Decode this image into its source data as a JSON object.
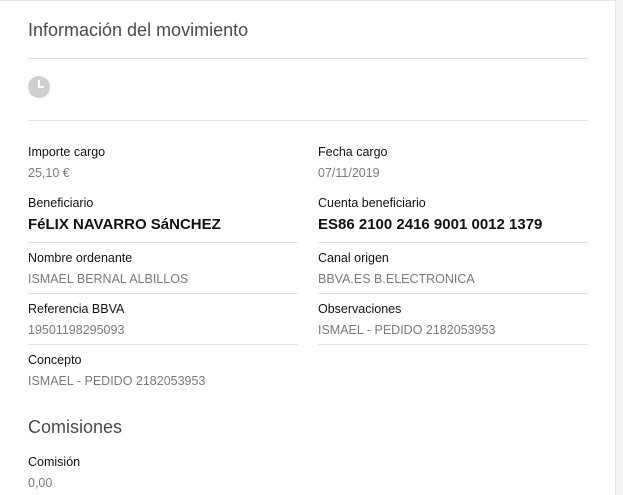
{
  "header": {
    "title": "Información del movimiento"
  },
  "details": {
    "importe_cargo": {
      "label": "Importe cargo",
      "value": "25,10 €"
    },
    "fecha_cargo": {
      "label": "Fecha cargo",
      "value": "07/11/2019"
    },
    "beneficiario": {
      "label": "Beneficiario",
      "value": "FéLIX NAVARRO SáNCHEZ"
    },
    "cuenta_beneficiario": {
      "label": "Cuenta beneficiario",
      "value": "ES86 2100 2416 9001 0012 1379"
    },
    "nombre_ordenante": {
      "label": "Nombre ordenante",
      "value": "ISMAEL BERNAL ALBILLOS"
    },
    "canal_origen": {
      "label": "Canal origen",
      "value": "BBVA.ES B.ELECTRONICA"
    },
    "referencia_bbva": {
      "label": "Referencia BBVA",
      "value": "19501198295093"
    },
    "observaciones": {
      "label": "Observaciones",
      "value": "ISMAEL - PEDIDO 2182053953"
    },
    "concepto": {
      "label": "Concepto",
      "value": "ISMAEL - PEDIDO 2182053953"
    }
  },
  "comisiones": {
    "title": "Comisiones",
    "comision": {
      "label": "Comisión",
      "value": "0,00"
    }
  },
  "icons": {
    "status": "clock-icon"
  },
  "colors": {
    "text": "#121212",
    "muted": "#7a7a7a",
    "divider": "#e1e1e1",
    "icon": "#cfcfcf"
  }
}
